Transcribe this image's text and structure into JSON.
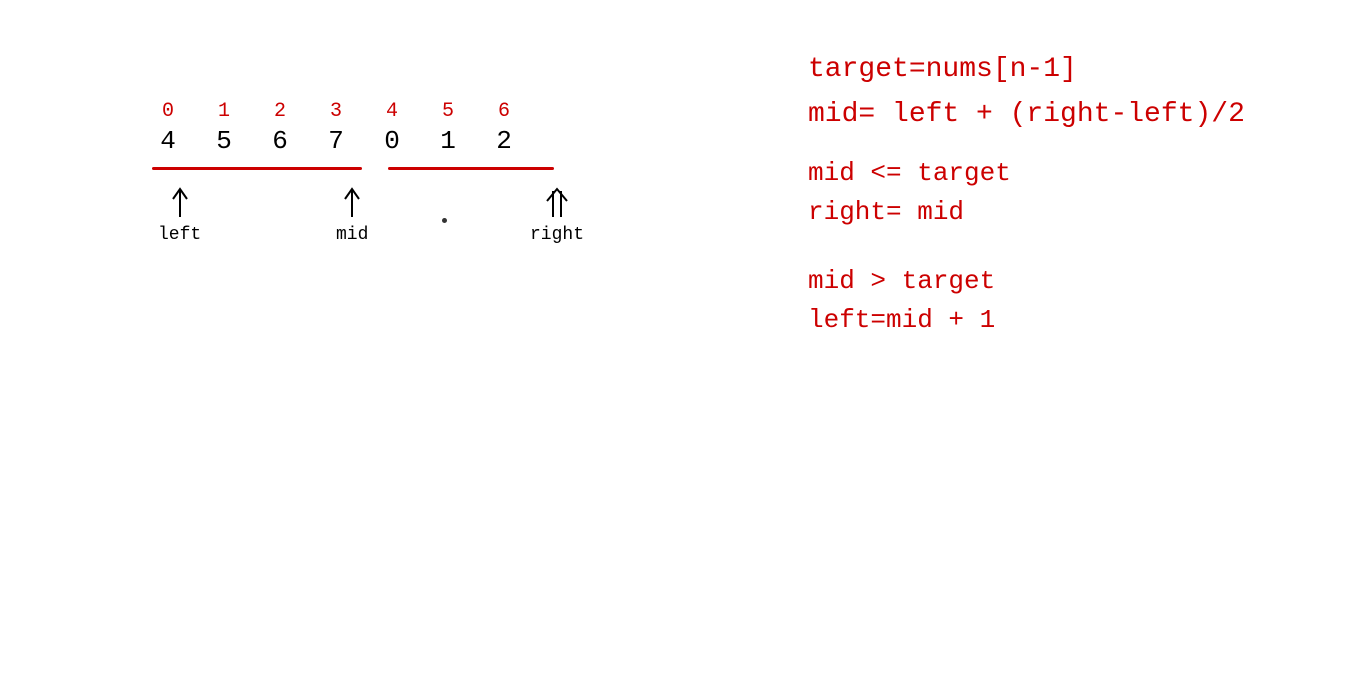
{
  "diagram": {
    "array": [
      {
        "index": "0",
        "value": "4"
      },
      {
        "index": "1",
        "value": "5"
      },
      {
        "index": "2",
        "value": "6"
      },
      {
        "index": "3",
        "value": "7"
      },
      {
        "index": "4",
        "value": "0"
      },
      {
        "index": "5",
        "value": "1"
      },
      {
        "index": "6",
        "value": "2"
      }
    ],
    "left_label": "left",
    "mid_label": "mid",
    "right_label": "right"
  },
  "formulas": {
    "line1": "target=nums[n-1]",
    "line2": "mid= left + (right-left)/2",
    "condition1a": "mid <= target",
    "condition1b": "right= mid",
    "condition2a": "mid > target",
    "condition2b": "left=mid + 1"
  },
  "colors": {
    "red": "#cc0000",
    "black": "#000000",
    "white": "#ffffff"
  }
}
